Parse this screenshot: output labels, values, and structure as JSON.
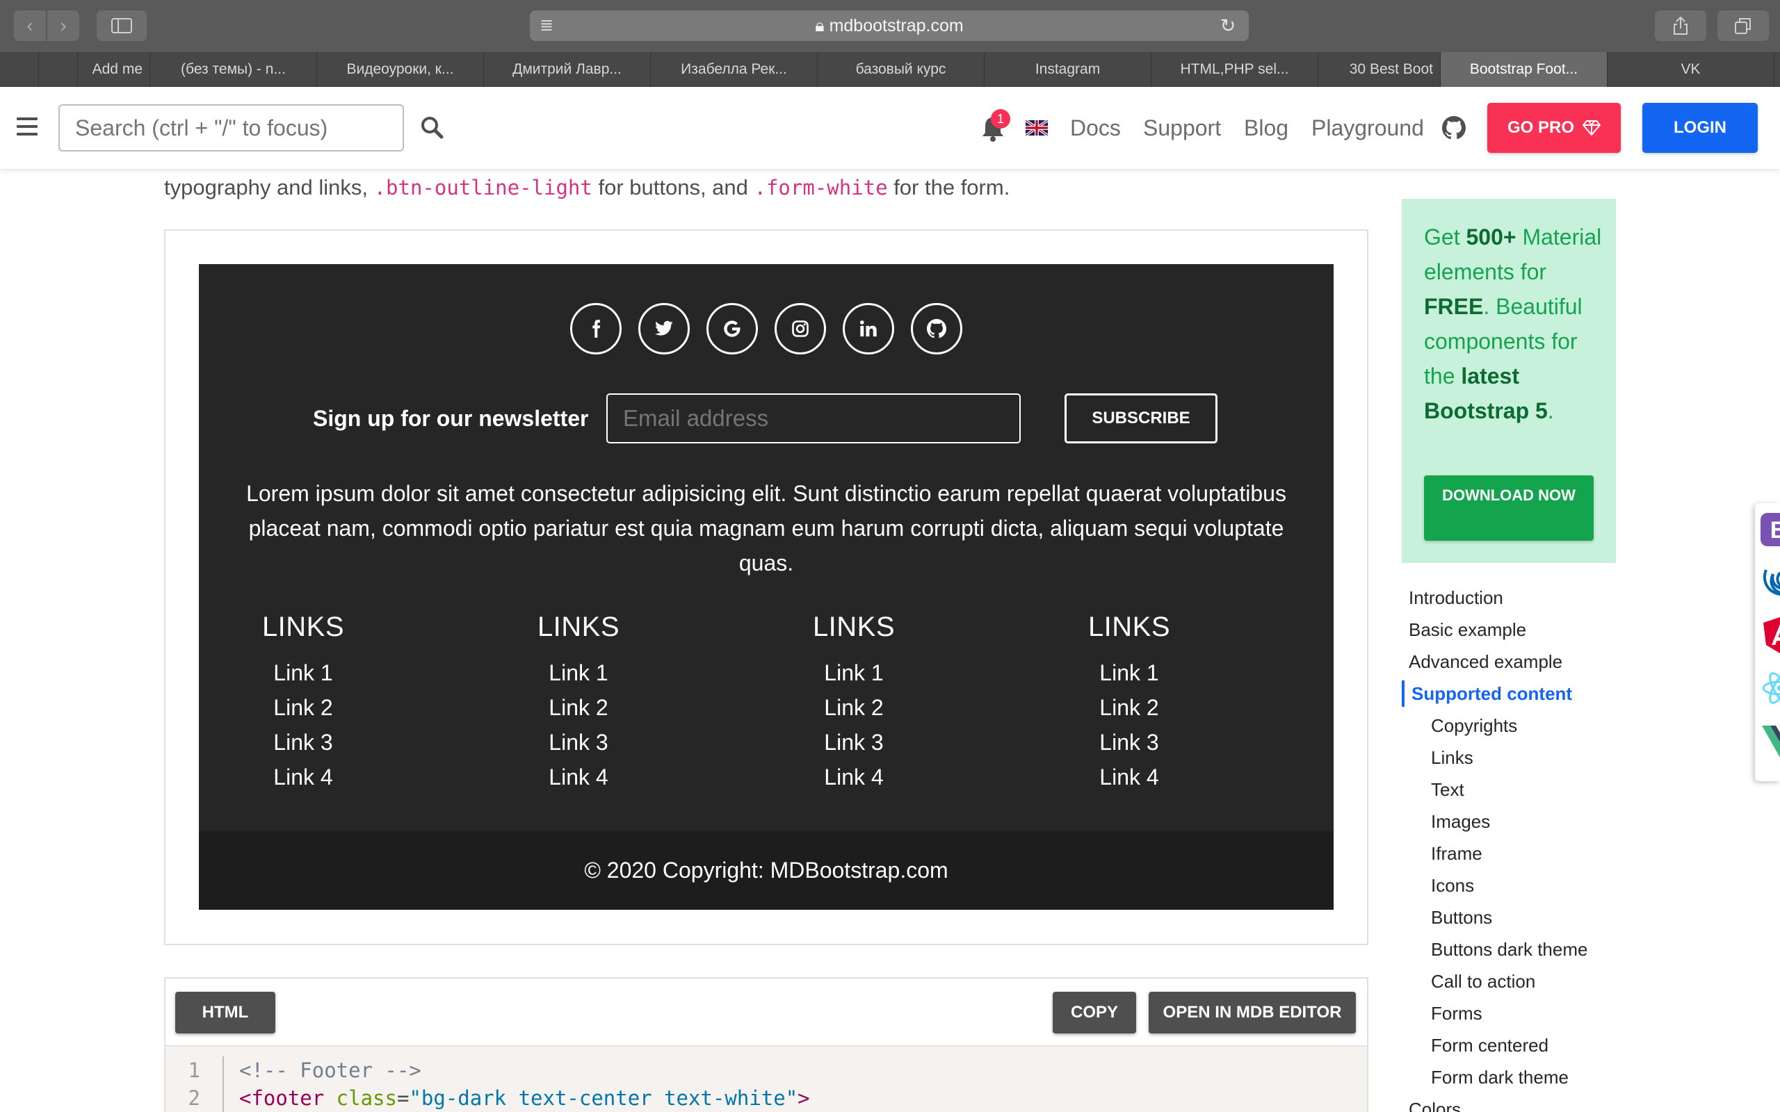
{
  "browser": {
    "url": "mdbootstrap.com",
    "tabs": [
      {
        "label": "",
        "type": "pinned"
      },
      {
        "label": "",
        "type": "pinned"
      },
      {
        "label": "Add me",
        "type": "short"
      },
      {
        "label": "(без темы) - n...",
        "type": "normal"
      },
      {
        "label": "Видеоуроки, к...",
        "type": "normal"
      },
      {
        "label": "Дмитрий Лавр...",
        "type": "normal"
      },
      {
        "label": "Изабелла Рек...",
        "type": "normal"
      },
      {
        "label": "базовый курс",
        "type": "normal"
      },
      {
        "label": "Instagram",
        "type": "normal"
      },
      {
        "label": "HTML,PHP sel...",
        "type": "normal"
      },
      {
        "label": "30 Best Boot",
        "type": "short"
      },
      {
        "label": "Bootstrap Foot...",
        "type": "active"
      },
      {
        "label": "VK",
        "type": "normal"
      }
    ]
  },
  "navbar": {
    "search_placeholder": "Search (ctrl + \"/\" to focus)",
    "notification_count": "1",
    "links": [
      "Docs",
      "Support",
      "Blog",
      "Playground"
    ],
    "gopro_label": "GO PRO",
    "login_label": "LOGIN"
  },
  "intro": {
    "part1": "typography and links, ",
    "code1": ".btn-outline-light",
    "part2": " for buttons, and ",
    "code2": ".form-white",
    "part3": " for the form."
  },
  "footer_demo": {
    "social_icons": [
      "facebook-icon",
      "twitter-icon",
      "google-icon",
      "instagram-icon",
      "linkedin-icon",
      "github-icon"
    ],
    "newsletter_label": "Sign up for our newsletter",
    "email_placeholder": "Email address",
    "subscribe_label": "SUBSCRIBE",
    "lorem": "Lorem ipsum dolor sit amet consectetur adipisicing elit. Sunt distinctio earum repellat quaerat voluptatibus placeat nam, commodi optio pariatur est quia magnam eum harum corrupti dicta, aliquam sequi voluptate quas.",
    "link_columns": [
      {
        "heading": "LINKS",
        "links": [
          "Link 1",
          "Link 2",
          "Link 3",
          "Link 4"
        ]
      },
      {
        "heading": "LINKS",
        "links": [
          "Link 1",
          "Link 2",
          "Link 3",
          "Link 4"
        ]
      },
      {
        "heading": "LINKS",
        "links": [
          "Link 1",
          "Link 2",
          "Link 3",
          "Link 4"
        ]
      },
      {
        "heading": "LINKS",
        "links": [
          "Link 1",
          "Link 2",
          "Link 3",
          "Link 4"
        ]
      }
    ],
    "copyright": "© 2020 Copyright: MDBootstrap.com"
  },
  "code_section": {
    "tab_label": "HTML",
    "copy_label": "COPY",
    "editor_label": "OPEN IN MDB EDITOR",
    "lines": [
      {
        "num": "1",
        "comment": "<!-- Footer -->"
      },
      {
        "num": "2",
        "tag_open": "<footer",
        "attr": " class",
        "eq": "=",
        "val": "\"bg-dark text-center text-white\"",
        "close": ">"
      }
    ]
  },
  "sidebar": {
    "promo": {
      "pre": "Get ",
      "b1": "500+",
      "mid1": " Material elements for ",
      "b2": "FREE",
      "mid2": ". Beautiful components for the ",
      "b3": "latest Bootstrap 5",
      "end": ".",
      "button": "DOWNLOAD NOW"
    },
    "toc": [
      {
        "label": "Introduction",
        "level": 1
      },
      {
        "label": "Basic example",
        "level": 1
      },
      {
        "label": "Advanced example",
        "level": 1
      },
      {
        "label": "Supported content",
        "level": 1,
        "active": true
      },
      {
        "label": "Copyrights",
        "level": 2
      },
      {
        "label": "Links",
        "level": 2
      },
      {
        "label": "Text",
        "level": 2
      },
      {
        "label": "Images",
        "level": 2
      },
      {
        "label": "Iframe",
        "level": 2
      },
      {
        "label": "Icons",
        "level": 2
      },
      {
        "label": "Buttons",
        "level": 2
      },
      {
        "label": "Buttons dark theme",
        "level": 2
      },
      {
        "label": "Call to action",
        "level": 2
      },
      {
        "label": "Forms",
        "level": 2
      },
      {
        "label": "Form centered",
        "level": 2
      },
      {
        "label": "Form dark theme",
        "level": 2
      },
      {
        "label": "Colors",
        "level": 1
      }
    ],
    "dock_icons": [
      "bootstrap-icon",
      "jquery-icon",
      "angular-icon",
      "react-icon",
      "vue-icon"
    ]
  },
  "colors": {
    "primary": "#1266f1",
    "danger": "#f93154",
    "success": "#14a44d",
    "footer_bg": "#262626"
  }
}
